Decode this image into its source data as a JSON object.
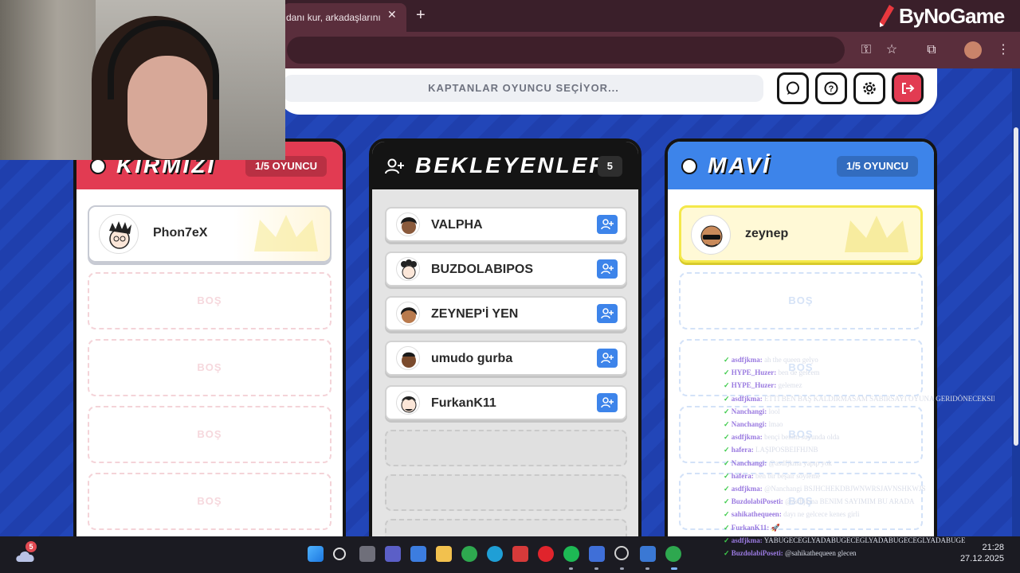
{
  "browser": {
    "tab_title": "danı kur, arkadaşlarını",
    "tab_close": "✕",
    "new_tab": "+",
    "brand": "ByNoGame"
  },
  "game": {
    "status": "KAPTANLAR OYUNCU SEÇİYOR...",
    "teams": {
      "red": {
        "title": "KIRMIZI",
        "count": "1/5 OYUNCU",
        "players": [
          {
            "name": "Phon7eX"
          }
        ],
        "empty_label": "BOŞ"
      },
      "waiting": {
        "title": "BEKLEYENLER",
        "count": "5",
        "players": [
          {
            "name": "VALPHA"
          },
          {
            "name": "BUZDOLABIPOS"
          },
          {
            "name": "ZEYNEP'İ YEN"
          },
          {
            "name": "umudo gurba"
          },
          {
            "name": "FurkanK11"
          }
        ]
      },
      "blue": {
        "title": "MAVİ",
        "count": "1/5 OYUNCU",
        "players": [
          {
            "name": "zeynep"
          }
        ],
        "empty_label": "BOŞ"
      }
    }
  },
  "chat": [
    {
      "user": "asdfjkma:",
      "msg": "ah the queen gelyo"
    },
    {
      "user": "HYPE_Huzer:",
      "msg": "ben de gelcem"
    },
    {
      "user": "HYPE_Huzer:",
      "msg": "gelemez"
    },
    {
      "user": "asdfjkma:",
      "msg": "ETTİ BEN BAŞ KALDIRMASAM SABIRSAYI OYUNA GERIDÖNECEKSINIZ"
    },
    {
      "user": "Nanchangi:",
      "msg": "lool"
    },
    {
      "user": "Nanchangi:",
      "msg": "lmao"
    },
    {
      "user": "asdfjkma:",
      "msg": "bençi benim suyunda olda"
    },
    {
      "user": "hafera:",
      "msg": "LAŞIPOSBEIFHJNB"
    },
    {
      "user": "Nanchangi:",
      "msg": "@asdfjkma yapıp yok"
    },
    {
      "user": "hafera:",
      "msg": "ben bir beşair söyleme"
    },
    {
      "user": "asdfjkma:",
      "msg": "@Nanchangi BSJHCHEKDBJWNWRSJAVNSHKWJS"
    },
    {
      "user": "BuzdolabiPoseti:",
      "msg": "@asdfjkma BENIM SAYIMIM BU ARADA"
    },
    {
      "user": "sahikathequeen:",
      "msg": "dayı ne gelcece kenes girli"
    },
    {
      "user": "FurkanK11:",
      "msg": "🚀"
    },
    {
      "user": "asdfjkma:",
      "msg": "YABUGECEGLYADABUGECEGLYADABUGECEGLYADABUGE"
    },
    {
      "user": "BuzdolabiPoseti:",
      "msg": "@sahikathequeen glecen"
    }
  ],
  "taskbar": {
    "weather_badge": "5",
    "time": "21:28",
    "date": "27.12.2025"
  },
  "colors": {
    "red": "#e23b52",
    "blue": "#3d84ea",
    "gold": "#f4e84a",
    "background": "#1f3fa8"
  }
}
